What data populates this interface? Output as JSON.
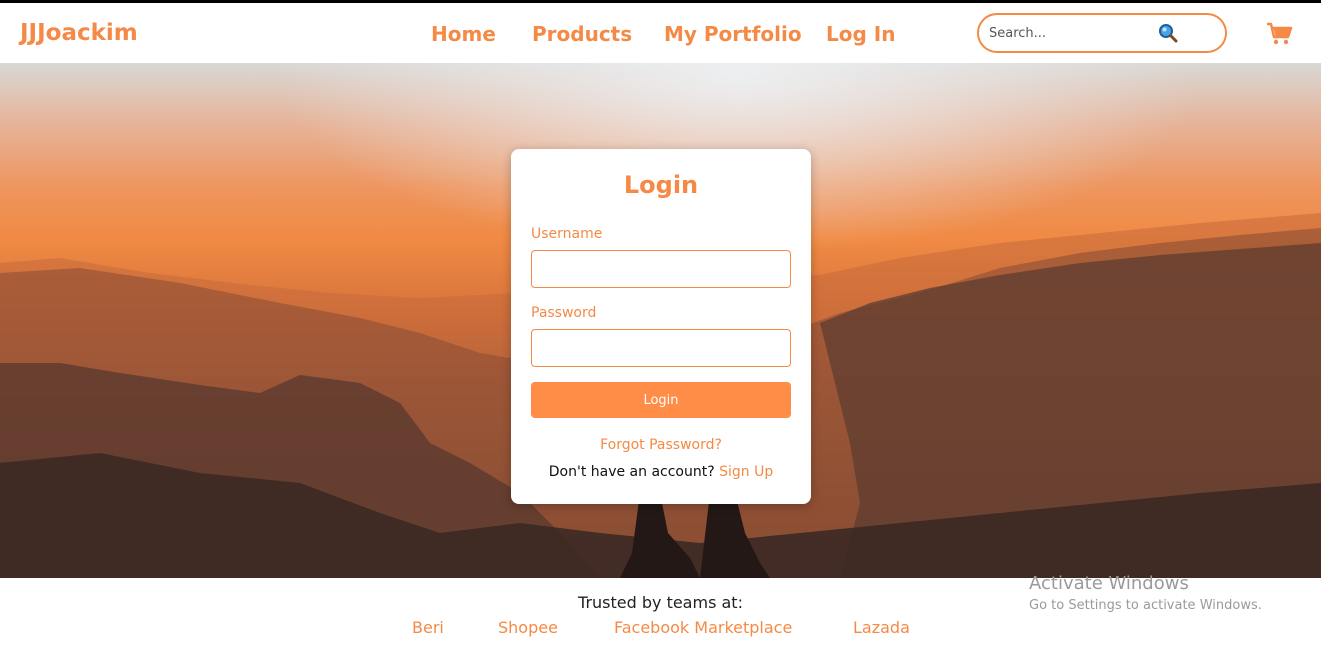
{
  "brand": "JJJoackim",
  "nav": {
    "items": [
      "Home",
      "Products",
      "My Portfolio",
      "Log In"
    ]
  },
  "search": {
    "placeholder": "Search...",
    "icon": "magnifier-icon"
  },
  "cart": {
    "icon": "shopping-cart-icon"
  },
  "login": {
    "title": "Login",
    "username_label": "Username",
    "username_value": "",
    "password_label": "Password",
    "password_value": "",
    "button_label": "Login",
    "forgot_label": "Forgot Password?",
    "no_account_text": "Don't have an account?",
    "signup_label": "Sign Up"
  },
  "footer": {
    "trusted_text": "Trusted by teams at:",
    "partners": [
      "Beri",
      "Shopee",
      "Facebook Marketplace",
      "Lazada"
    ]
  },
  "watermark": {
    "title": "Activate Windows",
    "subtitle": "Go to Settings to activate Windows."
  },
  "colors": {
    "accent": "#f48a45",
    "button": "#ff8c47"
  }
}
